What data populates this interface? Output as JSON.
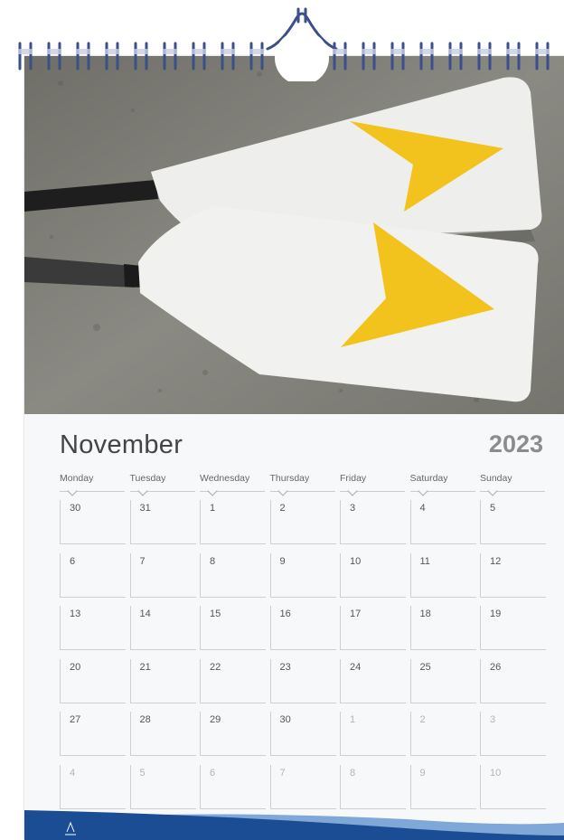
{
  "calendar": {
    "month": "November",
    "year": "2023",
    "weekdays": [
      "Monday",
      "Tuesday",
      "Wednesday",
      "Thursday",
      "Friday",
      "Saturday",
      "Sunday"
    ],
    "weeks": [
      [
        {
          "d": "30",
          "dim": false
        },
        {
          "d": "31",
          "dim": false
        },
        {
          "d": "1",
          "dim": false
        },
        {
          "d": "2",
          "dim": false
        },
        {
          "d": "3",
          "dim": false
        },
        {
          "d": "4",
          "dim": false
        },
        {
          "d": "5",
          "dim": false
        }
      ],
      [
        {
          "d": "6",
          "dim": false
        },
        {
          "d": "7",
          "dim": false
        },
        {
          "d": "8",
          "dim": false
        },
        {
          "d": "9",
          "dim": false
        },
        {
          "d": "10",
          "dim": false
        },
        {
          "d": "11",
          "dim": false
        },
        {
          "d": "12",
          "dim": false
        }
      ],
      [
        {
          "d": "13",
          "dim": false
        },
        {
          "d": "14",
          "dim": false
        },
        {
          "d": "15",
          "dim": false
        },
        {
          "d": "16",
          "dim": false
        },
        {
          "d": "17",
          "dim": false
        },
        {
          "d": "18",
          "dim": false
        },
        {
          "d": "19",
          "dim": false
        }
      ],
      [
        {
          "d": "20",
          "dim": false
        },
        {
          "d": "21",
          "dim": false
        },
        {
          "d": "22",
          "dim": false
        },
        {
          "d": "23",
          "dim": false
        },
        {
          "d": "24",
          "dim": false
        },
        {
          "d": "25",
          "dim": false
        },
        {
          "d": "26",
          "dim": false
        }
      ],
      [
        {
          "d": "27",
          "dim": false
        },
        {
          "d": "28",
          "dim": false
        },
        {
          "d": "29",
          "dim": false
        },
        {
          "d": "30",
          "dim": false
        },
        {
          "d": "1",
          "dim": true
        },
        {
          "d": "2",
          "dim": true
        },
        {
          "d": "3",
          "dim": true
        }
      ],
      [
        {
          "d": "4",
          "dim": true
        },
        {
          "d": "5",
          "dim": true
        },
        {
          "d": "6",
          "dim": true
        },
        {
          "d": "7",
          "dim": true
        },
        {
          "d": "8",
          "dim": true
        },
        {
          "d": "9",
          "dim": true
        },
        {
          "d": "10",
          "dim": true
        }
      ]
    ]
  },
  "photo": {
    "subject": "two rowing oar blades with yellow chevrons on concrete"
  },
  "colors": {
    "wire": "#3b4f8a",
    "stripe": "#1a4d94",
    "stripe_light": "#7fa8d8",
    "chevron": "#f2c21d",
    "blade": "#eef0ee"
  }
}
